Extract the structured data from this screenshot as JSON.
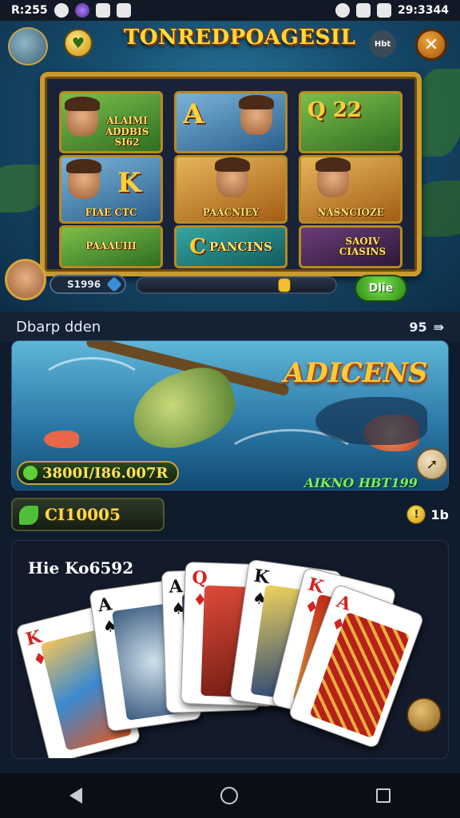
{
  "status_bar": {
    "time": "R:255",
    "clock_right": "29:3344"
  },
  "header": {
    "title": "TONREDPOAGESIL",
    "mini_button": "Hbt"
  },
  "board": {
    "tiles": [
      {
        "label": "ALAIMI ADDBIS SI62"
      },
      {
        "label": "",
        "big": "A"
      },
      {
        "label": "",
        "big": "Q  22"
      },
      {
        "label": "FIAE CTC",
        "big": "K"
      },
      {
        "label": "PAACNIEY"
      },
      {
        "label": "NASNCIOZE"
      },
      {
        "label": "PAAAUIII"
      },
      {
        "label": "PANCINS",
        "big": "C"
      },
      {
        "label": "SAOIV CIASINS"
      }
    ]
  },
  "player": {
    "gold": "S1996",
    "play_label": "Dlie"
  },
  "section": {
    "title": "Dbarp dden",
    "count": "95",
    "arrow": "⇛"
  },
  "banner": {
    "title": "ADICENS",
    "jackpot": "3800I/I86.007R",
    "subtitle": "AIKNO HBT199"
  },
  "coins": {
    "amount": "CI10005",
    "right_count": "1b"
  },
  "cards_panel": {
    "title": "Hie Ko6592",
    "cards": [
      {
        "rank": "K",
        "suit": "♦",
        "color": "red"
      },
      {
        "rank": "A",
        "suit": "♠",
        "color": "black"
      },
      {
        "rank": "A",
        "suit": "♠",
        "color": "black"
      },
      {
        "rank": "Q",
        "suit": "♦",
        "color": "red"
      },
      {
        "rank": "K",
        "suit": "♠",
        "color": "black"
      },
      {
        "rank": "K",
        "suit": "♦",
        "color": "red"
      },
      {
        "rank": "A",
        "suit": "♦",
        "color": "red"
      }
    ]
  },
  "colors": {
    "title_gold": "#ffd93b",
    "jackpot_gold": "#ffe15a",
    "play_green": "#2b8a1a"
  }
}
